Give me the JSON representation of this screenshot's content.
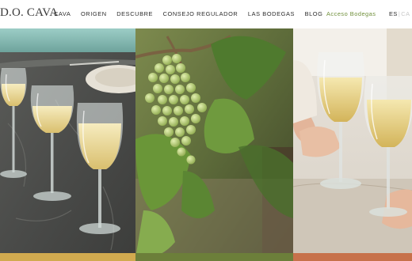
{
  "header": {
    "logo": "D.O. CAVA",
    "nav": [
      "CAVA",
      "ORIGEN",
      "DESCUBRE",
      "CONSEJO REGULADOR",
      "LAS BODEGAS",
      "BLOG"
    ],
    "access_label": "Acceso Bodegas",
    "lang_current": "ES",
    "lang_separator": "|",
    "lang_other": "CA"
  },
  "panels": [
    {
      "name": "cava-glasses",
      "strip_color": "#d1aa4f"
    },
    {
      "name": "vineyard-grapes",
      "strip_color": "#6c7f3a"
    },
    {
      "name": "toast",
      "strip_color": "#c7714a"
    }
  ],
  "colors": {
    "accent": "#6f8f3a"
  }
}
